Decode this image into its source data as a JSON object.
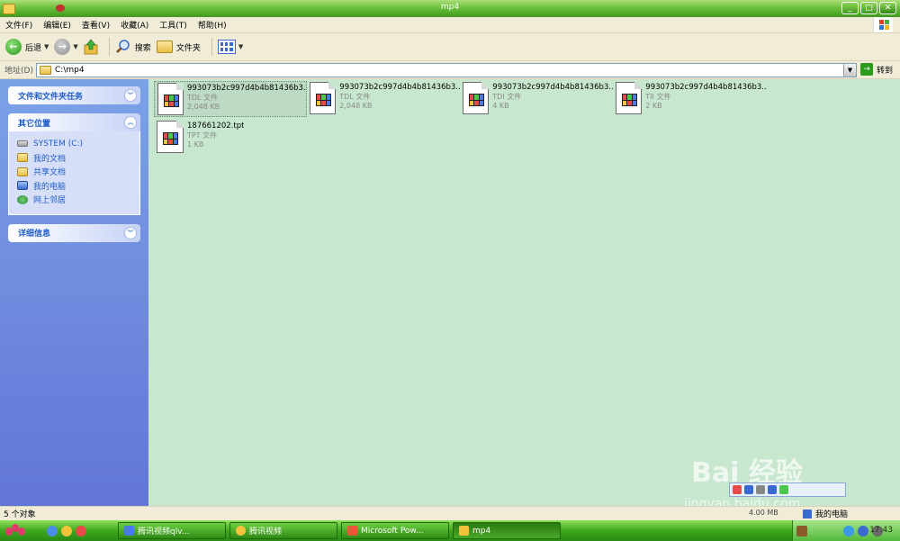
{
  "window": {
    "title": "mp4",
    "buttons": {
      "minimize": "_",
      "maximize": "□",
      "close": "✕"
    }
  },
  "menu": [
    "文件(F)",
    "编辑(E)",
    "查看(V)",
    "收藏(A)",
    "工具(T)",
    "帮助(H)"
  ],
  "toolbar": {
    "back_label": "后退",
    "search_label": "搜索",
    "folders_label": "文件夹"
  },
  "address": {
    "label": "地址(D)",
    "value": "C:\\mp4",
    "go_label": "转到"
  },
  "taskpane": {
    "file_tasks_title": "文件和文件夹任务",
    "other_places_title": "其它位置",
    "other_places": [
      {
        "label": "SYSTEM (C:)",
        "icon": "drive-icon"
      },
      {
        "label": "我的文档",
        "icon": "documents-icon"
      },
      {
        "label": "共享文档",
        "icon": "shared-folder-icon"
      },
      {
        "label": "我的电脑",
        "icon": "computer-icon"
      },
      {
        "label": "网上邻居",
        "icon": "network-icon"
      }
    ],
    "details_title": "详细信息"
  },
  "files": [
    {
      "name": "993073b2c997d4b4b81436b3...",
      "type": "TDL 文件",
      "size": "2,048 KB",
      "selected": true
    },
    {
      "name": "993073b2c997d4b4b81436b3...",
      "type": "TDL 文件",
      "size": "2,048 KB",
      "selected": false
    },
    {
      "name": "993073b2c997d4b4b81436b3...",
      "type": "TDI 文件",
      "size": "4 KB",
      "selected": false
    },
    {
      "name": "993073b2c997d4b4b81436b3...",
      "type": "TII 文件",
      "size": "2 KB",
      "selected": false
    },
    {
      "name": "187661202.tpt",
      "type": "TPT 文件",
      "size": "1 KB",
      "selected": false
    }
  ],
  "status": {
    "objects": "5 个对象",
    "size": "4.00 MB",
    "location": "我的电脑"
  },
  "taskbar": {
    "tasks": [
      {
        "label": "腾讯视频qlv...",
        "active": false
      },
      {
        "label": "腾讯视频",
        "active": false
      },
      {
        "label": "Microsoft Pow...",
        "active": false
      },
      {
        "label": "mp4",
        "active": true
      }
    ],
    "clock": "17:43"
  },
  "watermark": {
    "text": "Bai 经验",
    "sub": "jingyan.baidu.com"
  },
  "colors": {
    "file_area_bg": "#c7e8cf",
    "taskpane_blue": "#6375d6",
    "xp_green": "#3fa81e",
    "link_blue": "#215dc6"
  }
}
